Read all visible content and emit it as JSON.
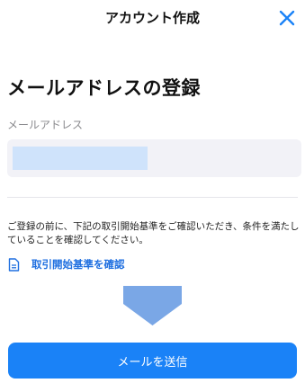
{
  "header": {
    "title": "アカウント作成",
    "close_icon": "close-icon"
  },
  "main": {
    "page_title": "メールアドレスの登録",
    "email_label": "メールアドレス",
    "email_value_redacted": true,
    "notice": "ご登録の前に、下記の取引開始基準をご確認いただき、条件を満たしていることを確認してください。",
    "criteria_link_label": "取引開始基準を確認",
    "criteria_link_icon": "document-icon",
    "arrow_icon": "arrow-down-icon",
    "send_button_label": "メールを送信"
  },
  "colors": {
    "accent": "#1a82f7",
    "link": "#1f6fe0",
    "arrow": "#7aa7e6",
    "field_bg": "#f2f2f7",
    "redaction": "#cfe3fb"
  }
}
